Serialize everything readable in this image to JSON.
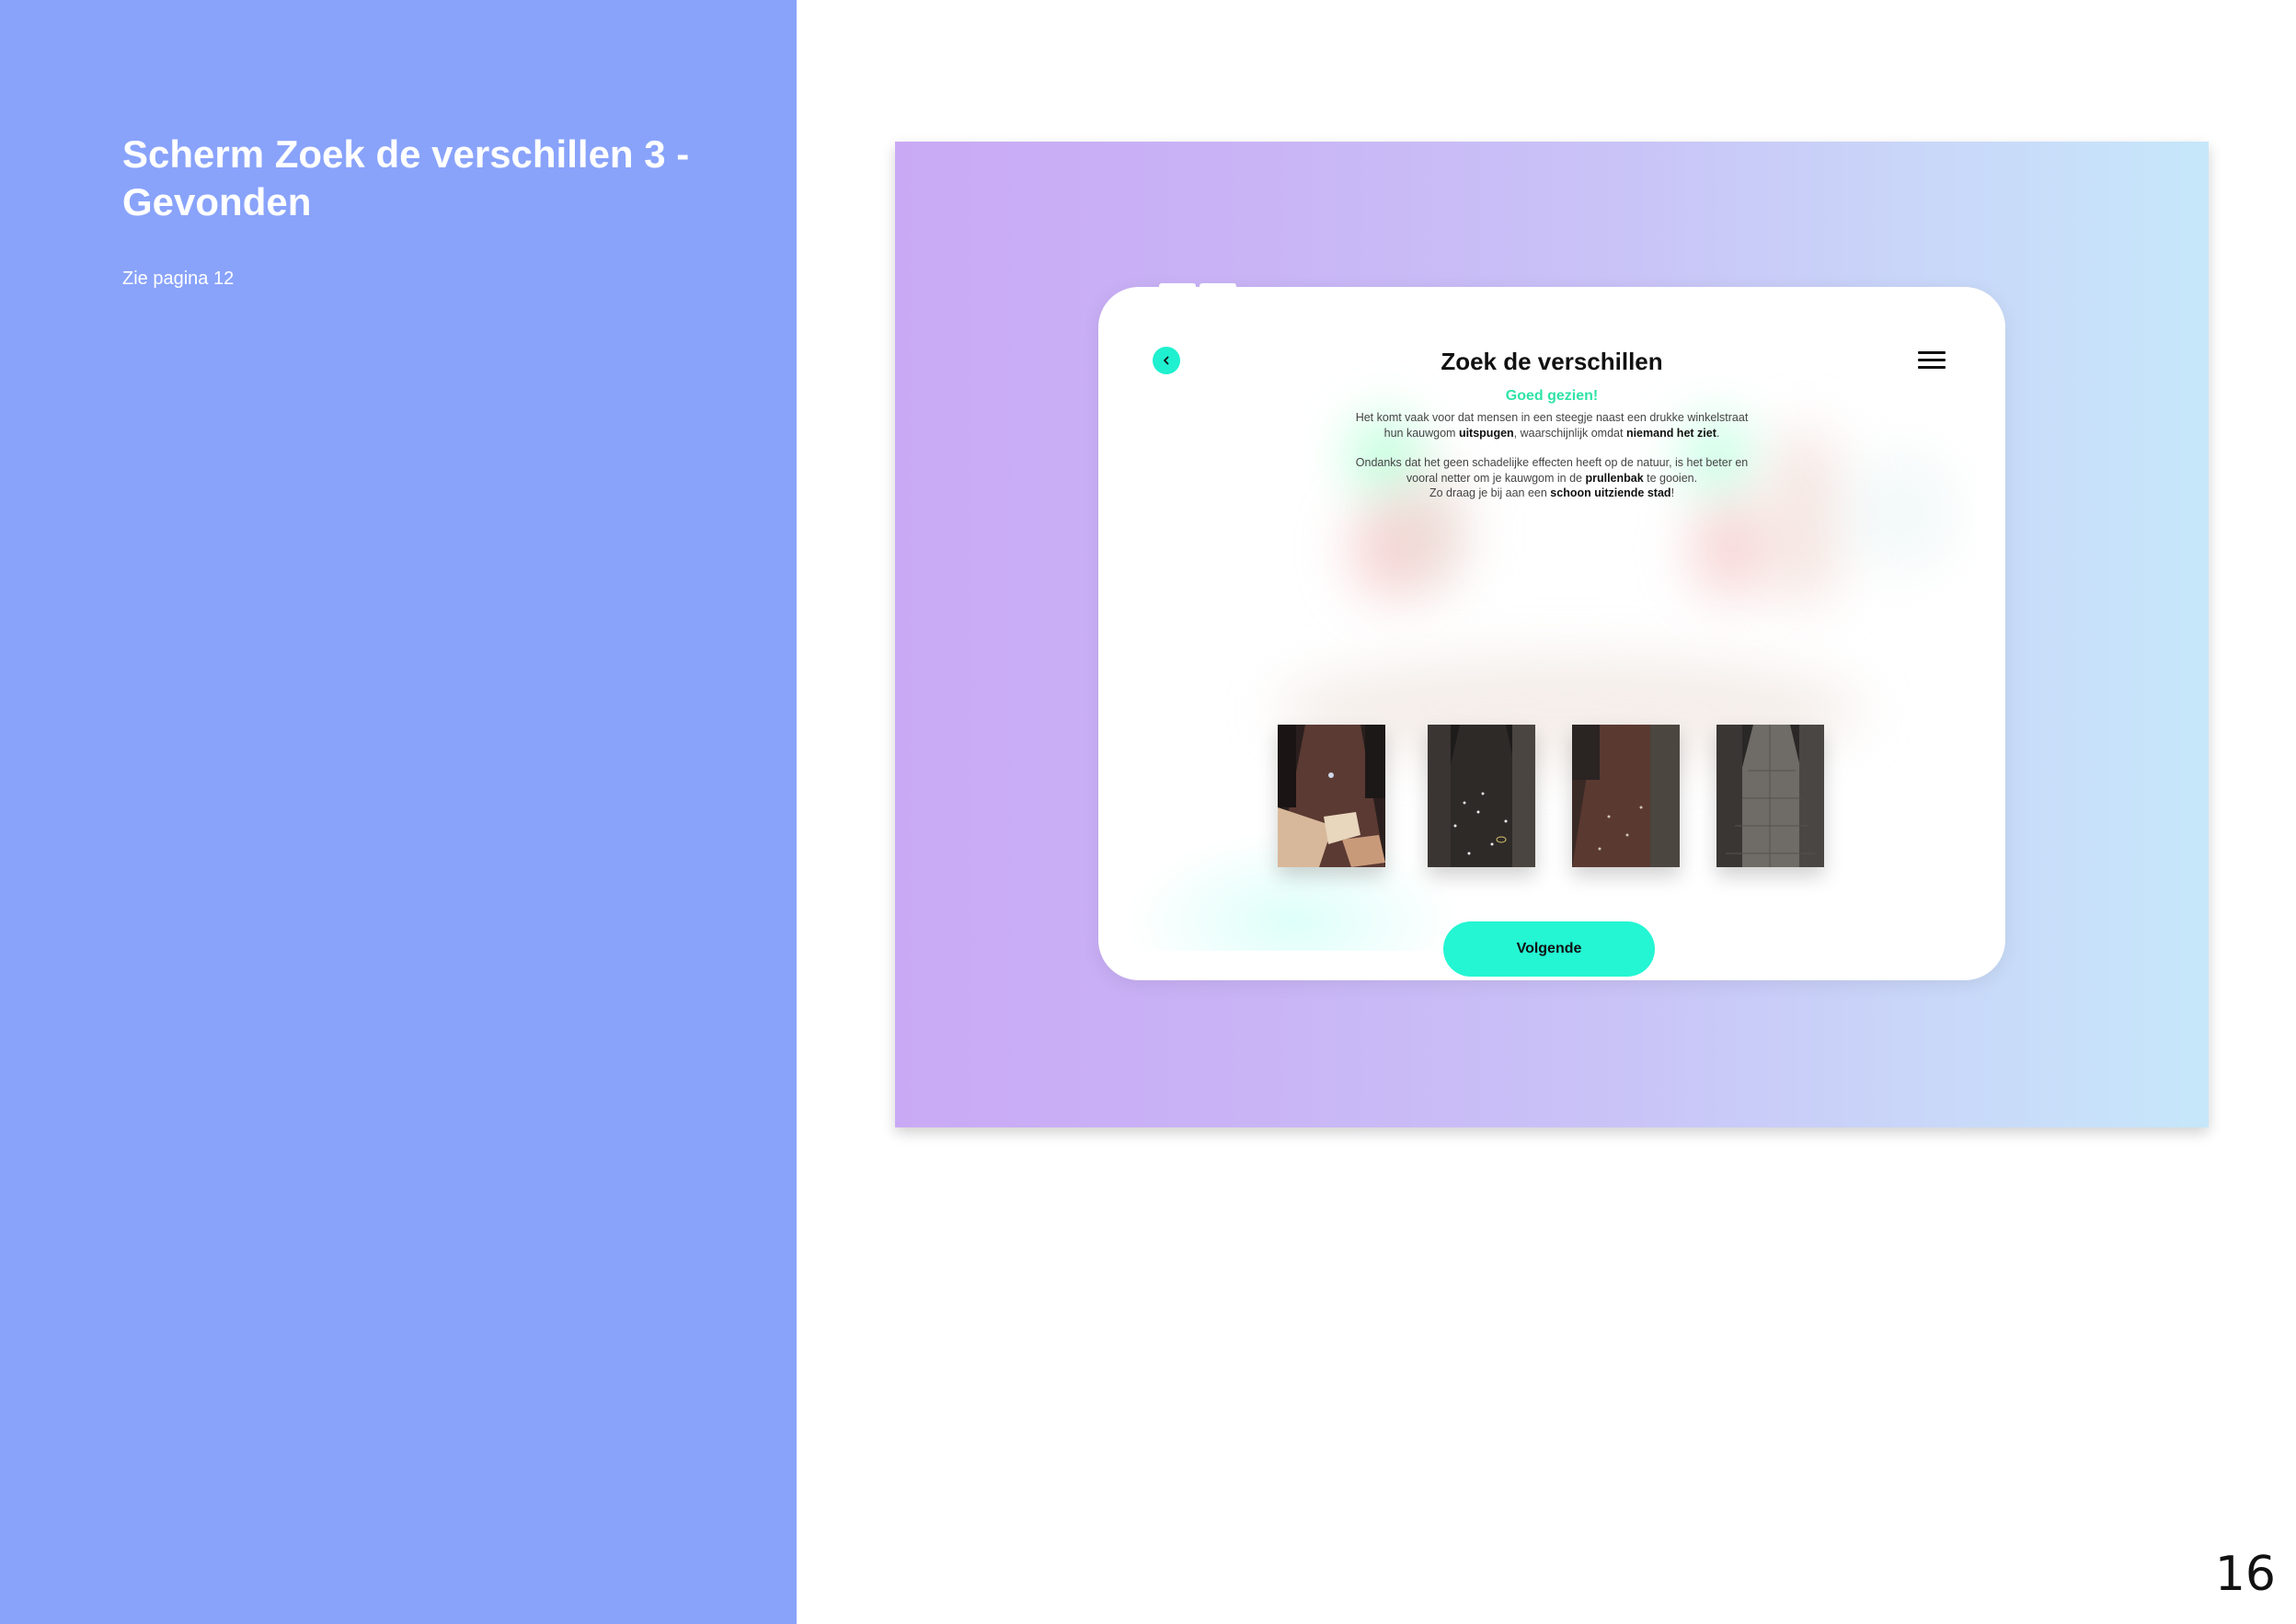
{
  "slide": {
    "title": "Scherm Zoek de verschillen 3  - Gevonden",
    "subtitle": "Zie pagina 12",
    "page_number": "16"
  },
  "screen": {
    "title": "Zoek de verschillen",
    "found_message": "Goed gezien!",
    "paragraph1": [
      {
        "text": "Het komt vaak voor dat mensen in een steegje naast een drukke winkelstraat hun kauwgom ",
        "bold": false
      },
      {
        "text": "uitspugen",
        "bold": true
      },
      {
        "text": ", waarschijnlijk omdat ",
        "bold": false
      },
      {
        "text": "niemand het ziet",
        "bold": true
      },
      {
        "text": ".",
        "bold": false
      }
    ],
    "paragraph2": [
      {
        "text": "Ondanks dat het geen schadelijke effecten heeft op de natuur, is het beter en vooral netter om je kauwgom in de ",
        "bold": false
      },
      {
        "text": "prullenbak",
        "bold": true
      },
      {
        "text": " te gooien.",
        "bold": false
      }
    ],
    "paragraph3": [
      {
        "text": "Zo draag je bij aan een ",
        "bold": false
      },
      {
        "text": "schoon uitziende stad",
        "bold": true
      },
      {
        "text": "!",
        "bold": false
      }
    ],
    "next_button": "Volgende",
    "photos": [
      "alley-photo-1",
      "alley-photo-2",
      "alley-photo-3",
      "alley-photo-4"
    ]
  },
  "colors": {
    "left_panel": "#89a3fb",
    "accent": "#24f5d3",
    "success_text": "#2fe3a7"
  },
  "icons": {
    "back": "chevron-left-icon",
    "menu": "hamburger-menu-icon"
  }
}
